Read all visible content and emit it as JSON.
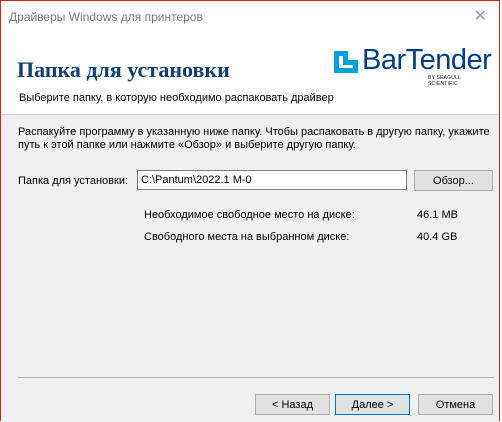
{
  "window": {
    "title": "Драйверы Windows для принтеров",
    "close_glyph": "✕"
  },
  "header": {
    "title": "Папка для установки",
    "subtitle": "Выберите папку, в которую необходимо распаковать драйвер",
    "logo": {
      "wordmark": "BarTender",
      "tagline": "BY SEAGULL SCIENTIFIC",
      "icon": "bartender-logo-icon",
      "colors": {
        "icon": "#009fdf",
        "text": "#003f87"
      }
    }
  },
  "body": {
    "description": "Распакуйте программу в указанную ниже папку. Чтобы распаковать в другую папку, укажите путь к этой папке или нажмите «Обзор» и выберите  другую папку.",
    "folder_label": "Папка для установки:",
    "folder_value": "C:\\Pantum\\2022.1 M-0",
    "browse_label": "Обзор...",
    "required_space_label": "Необходимое свободное место на диске:",
    "required_space_value": "46.1 MB",
    "free_space_label": "Свободного места на выбранном диске:",
    "free_space_value": "40.4 GB"
  },
  "footer": {
    "back_label": "< Назад",
    "next_label": "Далее >",
    "cancel_label": "Отмена"
  },
  "colors": {
    "title": "#123f73",
    "window_border": "#c42b1c",
    "panel_bg": "#f0f0f0"
  }
}
